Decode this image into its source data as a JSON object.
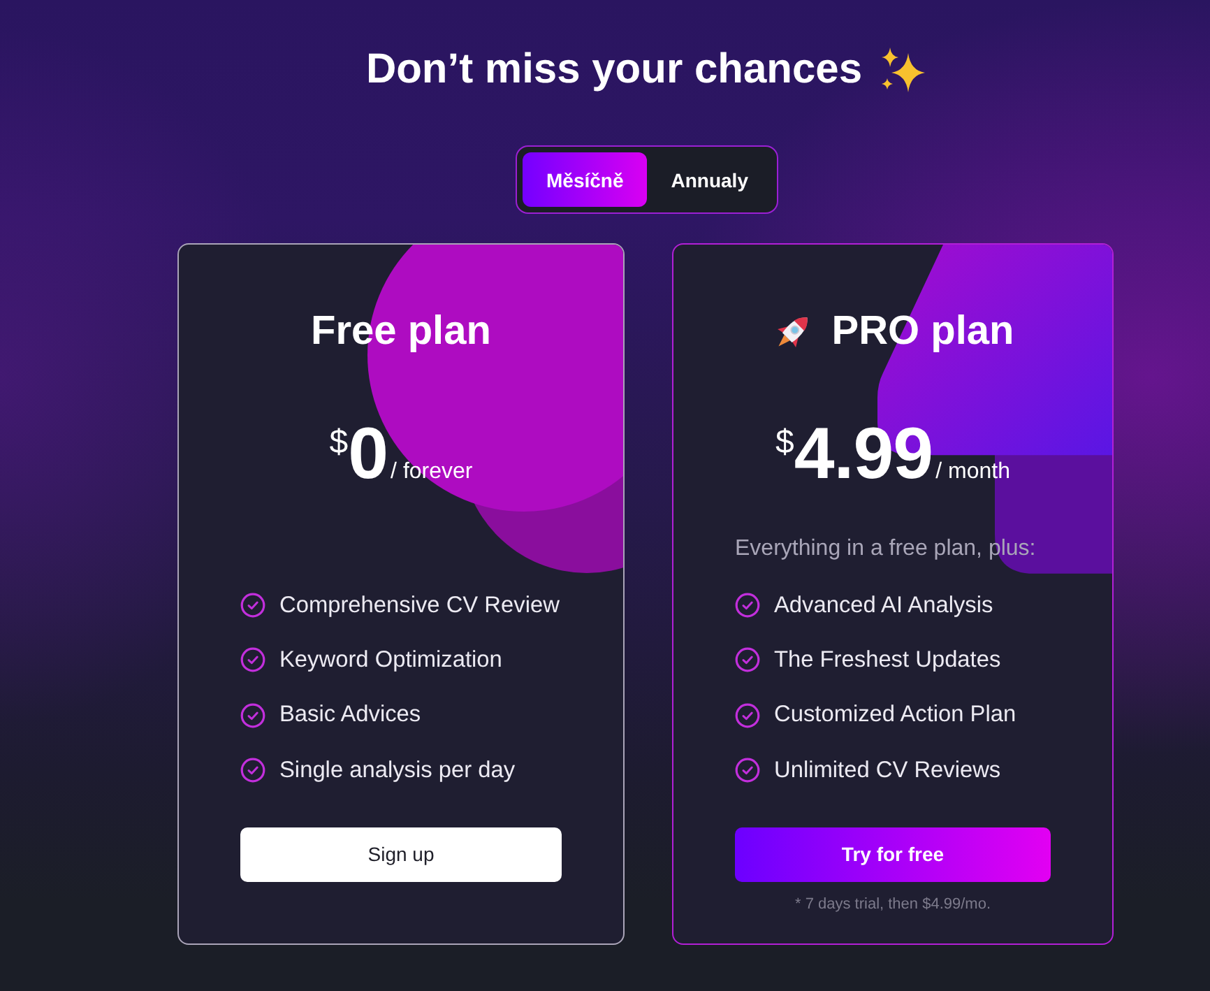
{
  "heading": "Don’t miss your chances",
  "billing_toggle": [
    {
      "label": "Měsíčně",
      "selected": true
    },
    {
      "label": "Annualy",
      "selected": false
    }
  ],
  "plans": [
    {
      "kind": "free",
      "title": "Free plan",
      "currency": "$",
      "price": "0",
      "period": "/ forever",
      "features": [
        "Comprehensive CV Review",
        "Keyword Optimization",
        "Basic Advices",
        "Single analysis per day"
      ],
      "button": "Sign up"
    },
    {
      "kind": "pro",
      "title": "PRO plan",
      "currency": "$",
      "price": "4.99",
      "period": "/ month",
      "intro": "Everything in a free plan, plus:",
      "features": [
        "Advanced AI Analysis",
        "The Freshest Updates",
        "Customized Action Plan",
        "Unlimited CV Reviews"
      ],
      "button": "Try for free",
      "footnote": "* 7 days trial, then $4.99/mo."
    }
  ]
}
